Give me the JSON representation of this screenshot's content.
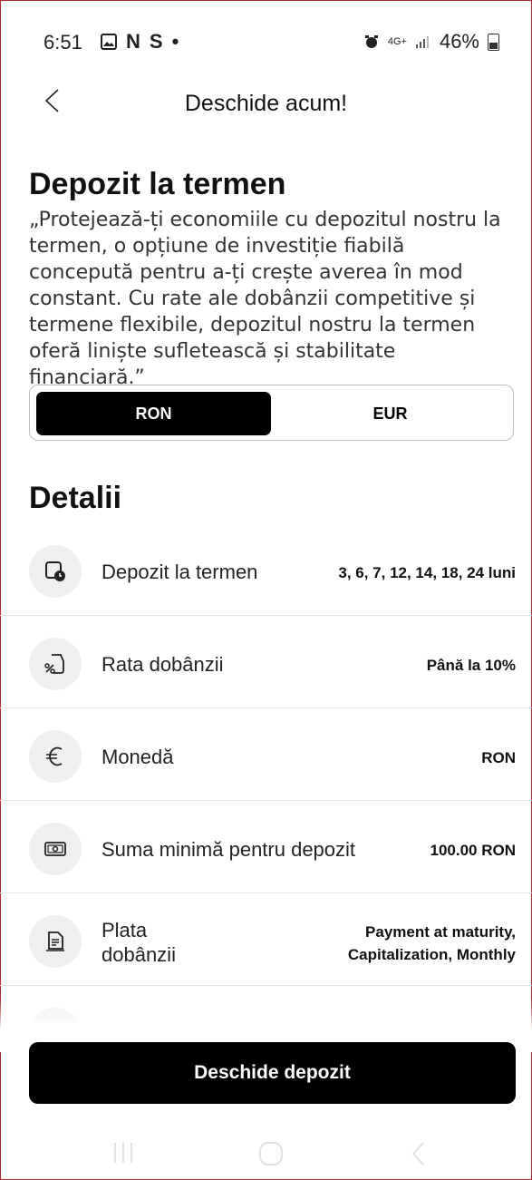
{
  "status_bar": {
    "time": "6:51",
    "notif_icons": [
      "N",
      "S",
      "•"
    ],
    "network": "4G+",
    "battery": "46%"
  },
  "header": {
    "title": "Deschide acum!"
  },
  "intro": {
    "title": "Depozit la termen",
    "description": "„Protejează-ți economiile cu depozitul nostru la termen, o opțiune de investiție fiabilă concepută pentru a-ți crește averea în mod constant. Cu rate ale dobânzii competitive și termene flexibile, depozitul nostru la termen oferă liniște sufletească și stabilitate financiară.”"
  },
  "currency_toggle": {
    "options": [
      "RON",
      "EUR"
    ],
    "selected": "RON"
  },
  "details": {
    "heading": "Detalii",
    "rows": [
      {
        "icon": "calendar-clock-icon",
        "label": "Depozit la termen",
        "value": "3, 6, 7, 12, 14, 18, 24 luni"
      },
      {
        "icon": "percent-tag-icon",
        "label": "Rata dobânzii",
        "value": "Până la 10%"
      },
      {
        "icon": "euro-icon",
        "label": "Monedă",
        "value": "RON"
      },
      {
        "icon": "banknote-icon",
        "label": "Suma minimă pentru depozit",
        "value": "100.00 RON"
      },
      {
        "icon": "document-icon",
        "label_line1": "Plata",
        "label_line2": "dobânzii",
        "value_line1": "Payment at maturity,",
        "value_line2": "Capitalization, Monthly"
      }
    ]
  },
  "cta": {
    "label": "Deschide depozit"
  },
  "colors": {
    "primary": "#000000",
    "icon_bg": "#f1eeee",
    "divider": "#e6e6e6",
    "frame": "#b3262c"
  }
}
